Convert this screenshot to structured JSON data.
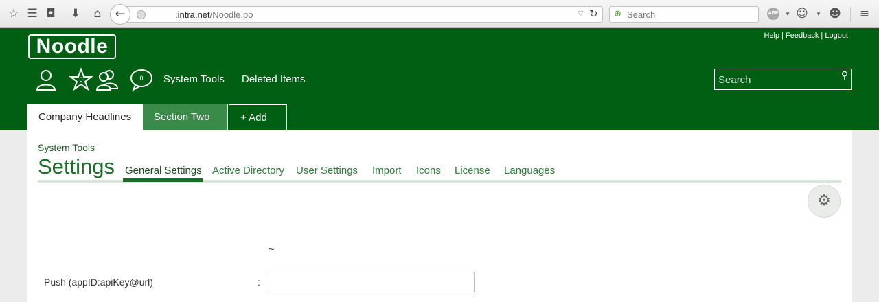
{
  "browser": {
    "url_host": ".intra.net",
    "url_path": "/Noodle.po",
    "search_placeholder": "Search",
    "abp_label": "ABP"
  },
  "header": {
    "logo": "Noodle",
    "links": [
      "Help",
      "Feedback",
      "Logout"
    ],
    "link_separator": " | ",
    "badges": {
      "favorites": "0",
      "messages": "0"
    },
    "nav": {
      "system_tools": "System Tools",
      "deleted_items": "Deleted Items"
    },
    "search_placeholder": "Search",
    "tabs": [
      "Company Headlines",
      "Section Two",
      "+ Add"
    ]
  },
  "page": {
    "breadcrumb": "System Tools",
    "title": "Settings",
    "subtabs": [
      "General Settings",
      "Active Directory",
      "User Settings",
      "Import",
      "Icons",
      "License",
      "Languages"
    ],
    "tilde": "~",
    "field_label": "Push (appID:apiKey@url)",
    "field_colon": ":",
    "field_value": ""
  },
  "colors": {
    "brand_green": "#005f13",
    "tab_two": "#3a8a4a",
    "link_green": "#2e7d3a"
  }
}
